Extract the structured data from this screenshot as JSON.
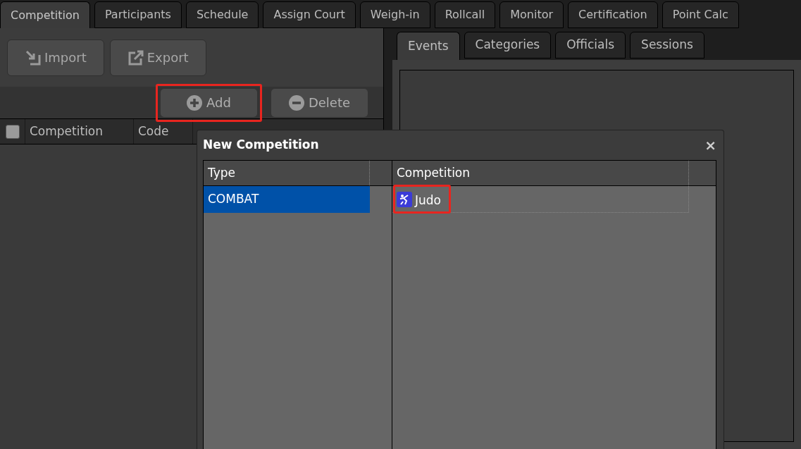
{
  "tabs": [
    {
      "label": "Competition",
      "selected": true
    },
    {
      "label": "Participants",
      "selected": false
    },
    {
      "label": "Schedule",
      "selected": false
    },
    {
      "label": "Assign Court",
      "selected": false
    },
    {
      "label": "Weigh-in",
      "selected": false
    },
    {
      "label": "Rollcall",
      "selected": false
    },
    {
      "label": "Monitor",
      "selected": false
    },
    {
      "label": "Certification",
      "selected": false
    },
    {
      "label": "Point Calc",
      "selected": false
    }
  ],
  "left_panel": {
    "toolbar": [
      {
        "label": "Import",
        "kind": "import"
      },
      {
        "label": "Export",
        "kind": "export"
      }
    ],
    "actions": [
      {
        "label": "Add",
        "kind": "add",
        "highlighted": true
      },
      {
        "label": "Delete",
        "kind": "delete",
        "highlighted": false
      }
    ],
    "table": {
      "select_all": {
        "checked": false
      },
      "columns": [
        "Competition",
        "Code"
      ]
    }
  },
  "right_panel": {
    "tabs": [
      {
        "label": "Events",
        "selected": true
      },
      {
        "label": "Categories",
        "selected": false
      },
      {
        "label": "Officials",
        "selected": false
      },
      {
        "label": "Sessions",
        "selected": false
      }
    ]
  },
  "dialog": {
    "title": "New Competition",
    "close": "×",
    "type_column": "Type",
    "types": [
      {
        "label": "COMBAT",
        "selected": true
      }
    ],
    "competition_column": "Competition",
    "competitions": [
      {
        "label": "Judo",
        "highlighted": true
      }
    ]
  }
}
